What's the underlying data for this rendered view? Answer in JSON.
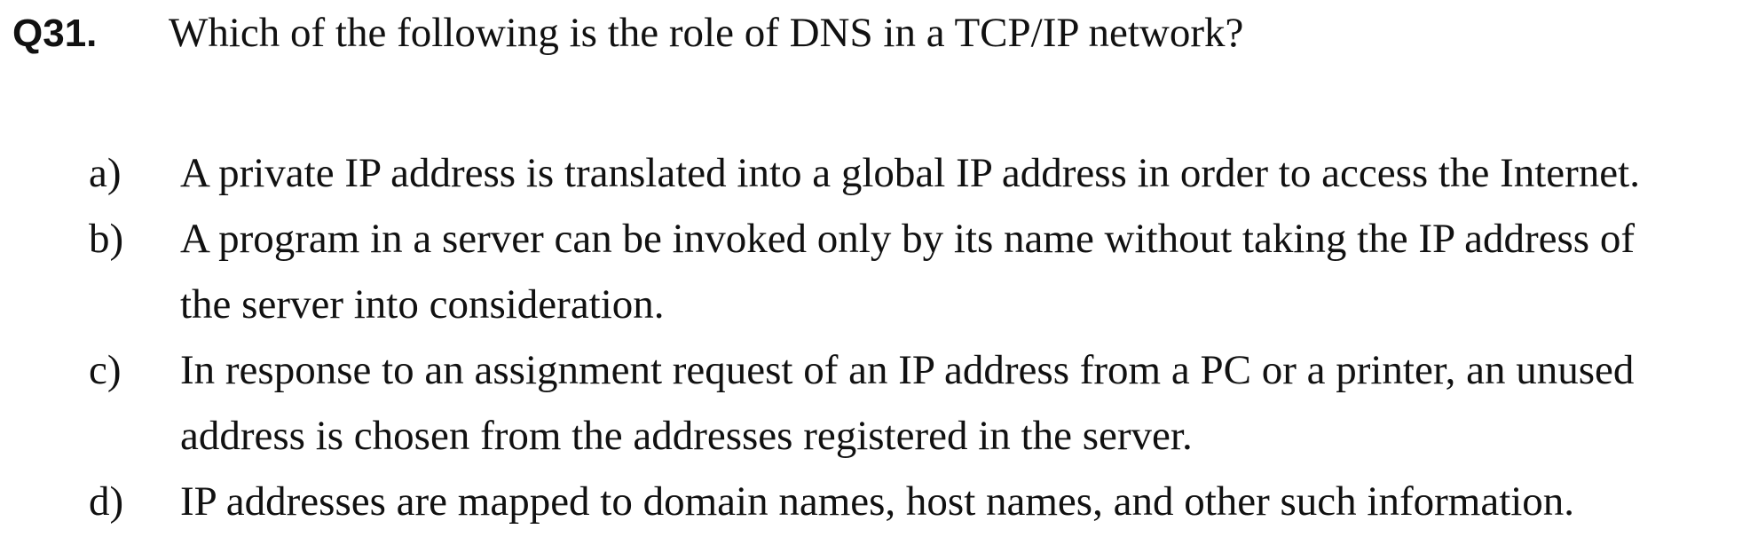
{
  "question": {
    "number": "Q31.",
    "text": "Which of the following is the role of DNS in a TCP/IP network?"
  },
  "options": [
    {
      "letter": "a)",
      "text": "A private IP address is translated into a global IP address in order to access the Internet."
    },
    {
      "letter": "b)",
      "text": "A program in a server can be invoked only by its name without taking the IP address of\nthe server into consideration."
    },
    {
      "letter": "c)",
      "text": "In response to an assignment request of an IP address from a PC or a printer, an unused\naddress is chosen from the addresses registered in the server."
    },
    {
      "letter": "d)",
      "text": "IP addresses are mapped to domain names, host names, and other such information."
    }
  ]
}
